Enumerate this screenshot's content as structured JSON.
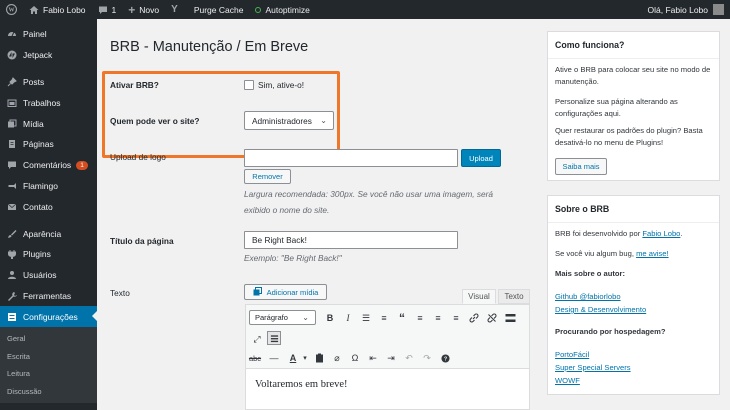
{
  "admin_bar": {
    "site_name": "Fabio Lobo",
    "comments_count": "1",
    "new_label": "Novo",
    "purge_label": "Purge Cache",
    "autoptimize_label": "Autoptimize",
    "greeting": "Olá, Fabio Lobo"
  },
  "sidebar": {
    "items": [
      {
        "label": "Painel",
        "icon": "dashboard-icon"
      },
      {
        "label": "Jetpack",
        "icon": "jetpack-icon"
      },
      {
        "label": "Posts",
        "icon": "pin-icon"
      },
      {
        "label": "Trabalhos",
        "icon": "portfolio-icon"
      },
      {
        "label": "Mídia",
        "icon": "media-icon"
      },
      {
        "label": "Páginas",
        "icon": "pages-icon"
      },
      {
        "label": "Comentários",
        "icon": "comments-icon",
        "badge": "1"
      },
      {
        "label": "Flamingo",
        "icon": "flamingo-icon"
      },
      {
        "label": "Contato",
        "icon": "mail-icon"
      },
      {
        "label": "Aparência",
        "icon": "brush-icon"
      },
      {
        "label": "Plugins",
        "icon": "plugin-icon"
      },
      {
        "label": "Usuários",
        "icon": "users-icon"
      },
      {
        "label": "Ferramentas",
        "icon": "tools-icon"
      },
      {
        "label": "Configurações",
        "icon": "settings-icon"
      }
    ],
    "submenu": [
      "Geral",
      "Escrita",
      "Leitura",
      "Discussão"
    ]
  },
  "main": {
    "title": "BRB - Manutenção / Em Breve",
    "activate_label": "Ativar BRB?",
    "activate_checkbox_label": "Sim, ative-o!",
    "who_label": "Quem pode ver o site?",
    "who_selected": "Administradores",
    "logo_label": "Upload de logo",
    "upload_button": "Upload",
    "remove_button": "Remover",
    "logo_desc": "Largura recomendada: 300px. Se você não usar uma imagem, será exibido o nome do site.",
    "page_title_label": "Título da página",
    "page_title_value": "Be Right Back!",
    "page_title_example": "Exemplo: \"Be Right Back!\"",
    "text_label": "Texto",
    "add_media_button": "Adicionar mídia",
    "tab_visual": "Visual",
    "tab_text": "Texto",
    "format_select": "Parágrafo",
    "editor_content": "Voltaremos em breve!"
  },
  "panel_how": {
    "title": "Como funciona?",
    "p1": "Ative o BRB para colocar seu site no modo de manutenção.",
    "p2": "Personalize sua página alterando as configurações aqui.",
    "p3": "Quer restaurar os padrões do plugin? Basta desativá-lo no menu de Plugins!",
    "button": "Saiba mais"
  },
  "panel_about": {
    "title": "Sobre o BRB",
    "dev_prefix": "BRB foi desenvolvido por ",
    "dev_link": "Fabio Lobo",
    "dev_suffix": ".",
    "bug_prefix": "Se você viu algum bug, ",
    "bug_link": "me avise!",
    "author_heading": "Mais sobre o autor:",
    "author_links": [
      "Github @fabiorlobo",
      "Design & Desenvolvimento"
    ],
    "hosting_heading": "Procurando por hospedagem?",
    "hosting_links": [
      "PortoFácil",
      "Super Special Servers",
      "WOWF"
    ]
  },
  "colors": {
    "admin_bar": "#23282d",
    "accent": "#0073aa",
    "highlight": "#f0772a",
    "badge": "#d54e21"
  }
}
